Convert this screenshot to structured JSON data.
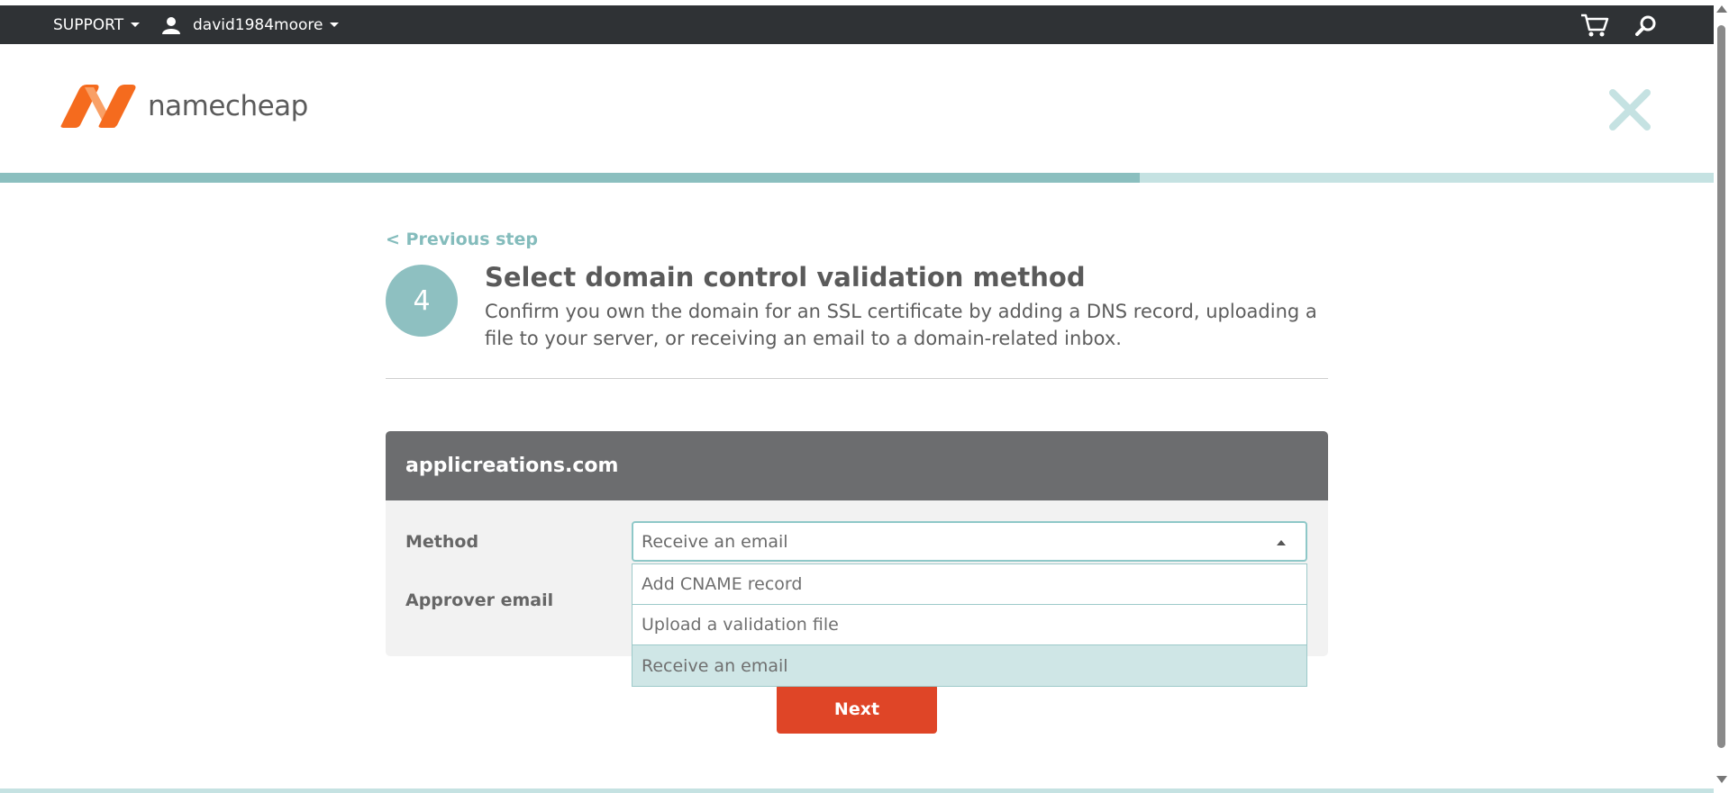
{
  "topbar": {
    "support_label": "SUPPORT",
    "username": "david1984moore",
    "icons": [
      "user-icon",
      "cart-icon",
      "search-icon"
    ]
  },
  "brand": {
    "logo_text": "namecheap",
    "logo_colors": [
      "#f56b1e",
      "#fb8a3c"
    ]
  },
  "progress": {
    "fraction": 0.665
  },
  "nav": {
    "previous_step": "< Previous step"
  },
  "step": {
    "number": "4",
    "title": "Select domain control validation method",
    "description": "Confirm you own the domain for an SSL certificate by adding a DNS record, uploading a file to your server, or receiving an email to a domain-related inbox."
  },
  "panel": {
    "domain": "applicreations.com",
    "method_label": "Method",
    "method_value": "Receive an email",
    "approver_label": "Approver email",
    "options": [
      "Add CNAME record",
      "Upload a validation file",
      "Receive an email"
    ],
    "selected_option": "Receive an email"
  },
  "actions": {
    "next_label": "Next"
  },
  "colors": {
    "topbar_bg": "#2f3235",
    "accent_teal": "#8ec0c1",
    "progress_track": "#c5e2e2",
    "panel_header": "#6c6d6f",
    "next_button": "#df4527"
  }
}
